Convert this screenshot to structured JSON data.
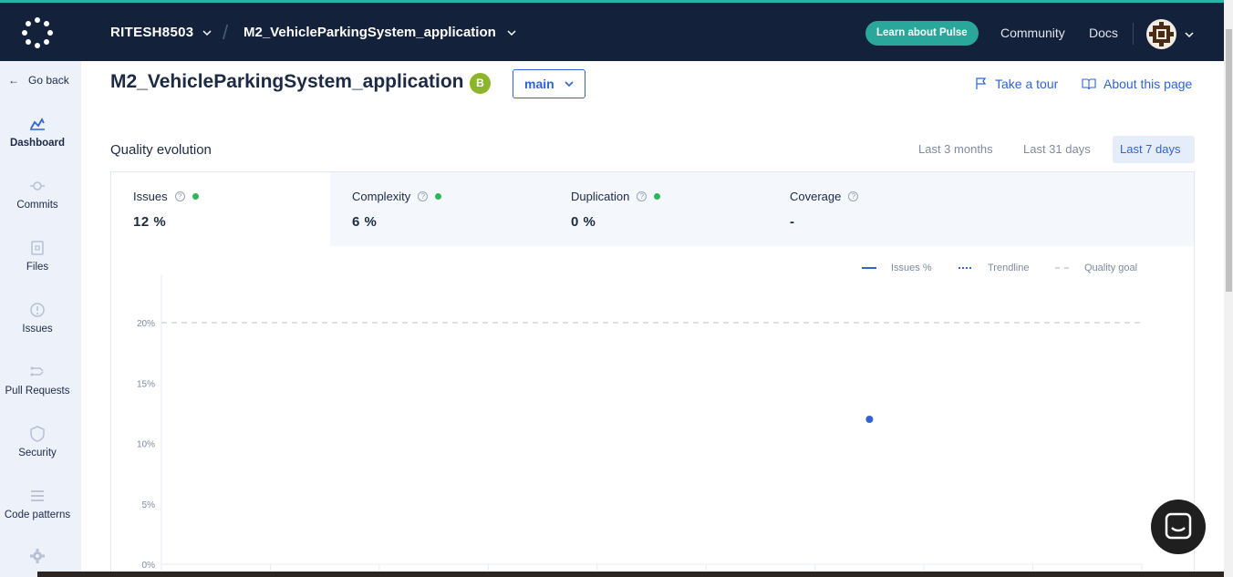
{
  "topbar": {
    "org": "RITESH8503",
    "repo": "M2_VehicleParkingSystem_application",
    "pulse_button": "Learn about Pulse",
    "community": "Community",
    "docs": "Docs"
  },
  "sidebar": {
    "go_back": "Go back",
    "items": [
      {
        "label": "Dashboard",
        "icon": "dashboard-icon"
      },
      {
        "label": "Commits",
        "icon": "commit-icon"
      },
      {
        "label": "Files",
        "icon": "file-icon"
      },
      {
        "label": "Issues",
        "icon": "issue-icon"
      },
      {
        "label": "Pull Requests",
        "icon": "pull-request-icon"
      },
      {
        "label": "Security",
        "icon": "shield-icon"
      },
      {
        "label": "Code patterns",
        "icon": "list-icon"
      },
      {
        "label": "",
        "icon": "gear-icon"
      }
    ]
  },
  "header": {
    "title": "M2_VehicleParkingSystem_application",
    "grade": "B",
    "branch": "main",
    "take_tour": "Take a tour",
    "about_page": "About this page"
  },
  "quality": {
    "title": "Quality evolution",
    "ranges": [
      "Last 3 months",
      "Last 31 days",
      "Last 7 days"
    ],
    "active_range": "Last 7 days",
    "metrics": [
      {
        "label": "Issues",
        "value": "12 %",
        "status": "good"
      },
      {
        "label": "Complexity",
        "value": "6 %",
        "status": "good"
      },
      {
        "label": "Duplication",
        "value": "0 %",
        "status": "good"
      },
      {
        "label": "Coverage",
        "value": "-",
        "status": "none"
      }
    ]
  },
  "chart_data": {
    "type": "scatter",
    "legend": [
      "Issues %",
      "Trendline",
      "Quality goal"
    ],
    "y_ticks": [
      "0%",
      "5%",
      "10%",
      "15%",
      "20%"
    ],
    "ylim": [
      0,
      24
    ],
    "quality_goal": 20,
    "series": [
      {
        "name": "Issues %",
        "points": [
          {
            "index": 6,
            "value": 12
          }
        ]
      }
    ],
    "x_count": 9,
    "colors": {
      "series": "#2f63d6",
      "goal": "#c8ccd4"
    },
    "legend_position": "top-right"
  },
  "colors": {
    "topbar": "#14213a",
    "accent": "#2aa79b",
    "link": "#2f63d6",
    "good": "#2fb65a"
  }
}
